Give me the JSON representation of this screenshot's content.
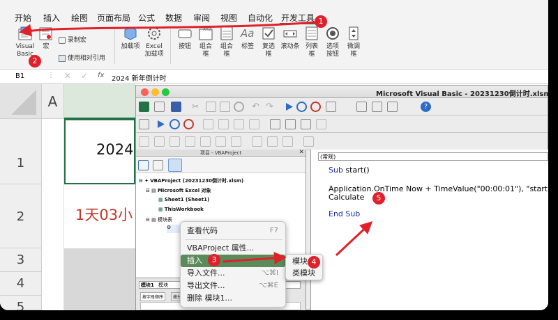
{
  "ribbon": {
    "tabs": [
      "开始",
      "插入",
      "绘图",
      "页面布局",
      "公式",
      "数据",
      "审阅",
      "视图",
      "自动化",
      "开发工具"
    ],
    "buttons": {
      "visual_basic": "Visual Basic",
      "macros": "宏",
      "record_macro": "录制宏",
      "relative_ref": "使用相对引用",
      "addins": "加载项",
      "excel_addins": "Excel 加载项",
      "button": "按钮",
      "group_box": "组合框",
      "combo_box": "组合框",
      "label": "标签",
      "checkbox": "复选框",
      "scrollbar": "滚动条",
      "listbox": "列表框",
      "option_button": "选项按钮",
      "spinner": "微调框"
    }
  },
  "formula_bar": {
    "cell_ref": "B1",
    "fx": "fx",
    "content": "2024 新年倒计时"
  },
  "sheet": {
    "col_a": "A",
    "rows": [
      "1",
      "2",
      "3",
      "4",
      "5"
    ],
    "cell_b1": "2024",
    "cell_b2": "1天03小"
  },
  "vba": {
    "title": "Microsoft Visual Basic - 20231230倒计时.xlsm -",
    "project_pane_title": "项目 - VBAProject",
    "tree": {
      "root": "VBAProject (20231230倒计时.xlsm)",
      "excel_objects": "Microsoft Excel 对象",
      "sheet1": "Sheet1 (Sheet1)",
      "thisworkbook": "ThisWorkbook",
      "modules": "模块表",
      "module1": "模块1"
    },
    "props": {
      "title": "模块1",
      "subtitle": "模块",
      "tab_alpha": "按字母顺序",
      "tab_cat": "按分"
    },
    "code": {
      "object_dropdown": "(常规)",
      "lines": [
        {
          "kw": "Sub",
          "text": " start()"
        },
        {
          "kw": "",
          "text": "Application.OnTime Now + TimeValue(\"00:00:01\"), \"start\""
        },
        {
          "kw": "",
          "text": "Calculate"
        },
        {
          "kw": "End Sub",
          "text": ""
        }
      ]
    }
  },
  "context_menu": {
    "items": [
      {
        "label": "查看代码",
        "shortcut": "F7"
      },
      {
        "label": "VBAProject 属性...",
        "shortcut": ""
      },
      {
        "label": "插入",
        "shortcut": ""
      },
      {
        "label": "导入文件...",
        "shortcut": "⌥⌘I"
      },
      {
        "label": "导出文件...",
        "shortcut": "⌥⌘E"
      },
      {
        "label": "删除 模块1...",
        "shortcut": ""
      }
    ],
    "submenu": [
      "模块",
      "类模块"
    ]
  },
  "annotations": [
    "1",
    "2",
    "3",
    "4",
    "5"
  ],
  "colors": {
    "excel_green": "#217346",
    "annotation_red": "#e0202a",
    "menu_highlight": "#5b8a5b",
    "code_keyword": "#1a2aa8",
    "cell_text_red": "#c0392b"
  }
}
